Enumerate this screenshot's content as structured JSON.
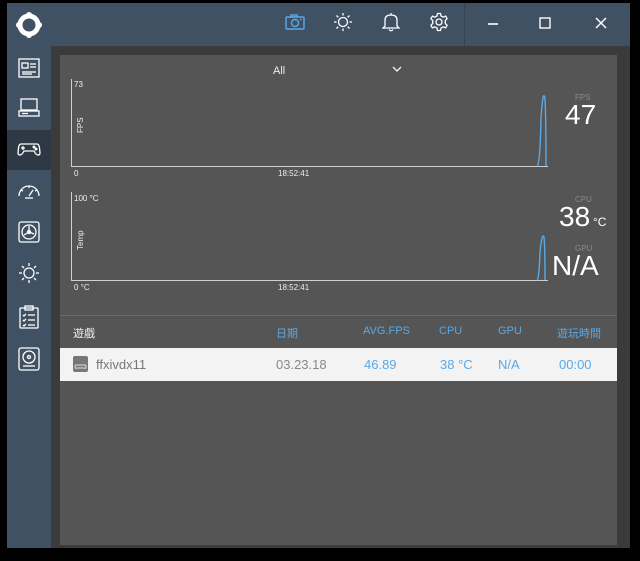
{
  "sidebar": {
    "items": [
      {
        "icon": "dashboard-icon"
      },
      {
        "icon": "computer-icon"
      },
      {
        "icon": "gamepad-icon",
        "active": true
      },
      {
        "icon": "speedometer-icon"
      },
      {
        "icon": "fan-icon"
      },
      {
        "icon": "brightness-icon"
      },
      {
        "icon": "clipboard-list-icon"
      },
      {
        "icon": "disk-icon"
      }
    ]
  },
  "topbar": {
    "icons": [
      "camera-icon",
      "brightness-icon",
      "bell-icon",
      "gear-icon",
      "minimize-icon",
      "maximize-icon",
      "close-icon"
    ],
    "accent": "#5aa9e6"
  },
  "filter": {
    "value": "All"
  },
  "fps_chart": {
    "axis_label": "FPS",
    "y_max": "73",
    "y_min": "0",
    "x_time": "18:52:41",
    "current_label": "FPS",
    "current_value": "47"
  },
  "temp_chart": {
    "axis_label": "Temp",
    "y_max": "100 °C",
    "y_min": "0 °C",
    "x_time": "18:52:41",
    "cpu_label": "CPU",
    "cpu_value": "38",
    "cpu_unit": "°C",
    "gpu_label": "GPU",
    "gpu_value": "N/A"
  },
  "table": {
    "headers": {
      "game": "遊戲",
      "date": "日期",
      "avg_fps": "AVG.FPS",
      "cpu": "CPU",
      "gpu": "GPU",
      "play_time": "遊玩時間"
    },
    "rows": [
      {
        "game": "ffxivdx11",
        "date": "03.23.18",
        "avg_fps": "46.89",
        "cpu": "38 °C",
        "gpu": "N/A",
        "play_time": "00:00"
      }
    ]
  }
}
